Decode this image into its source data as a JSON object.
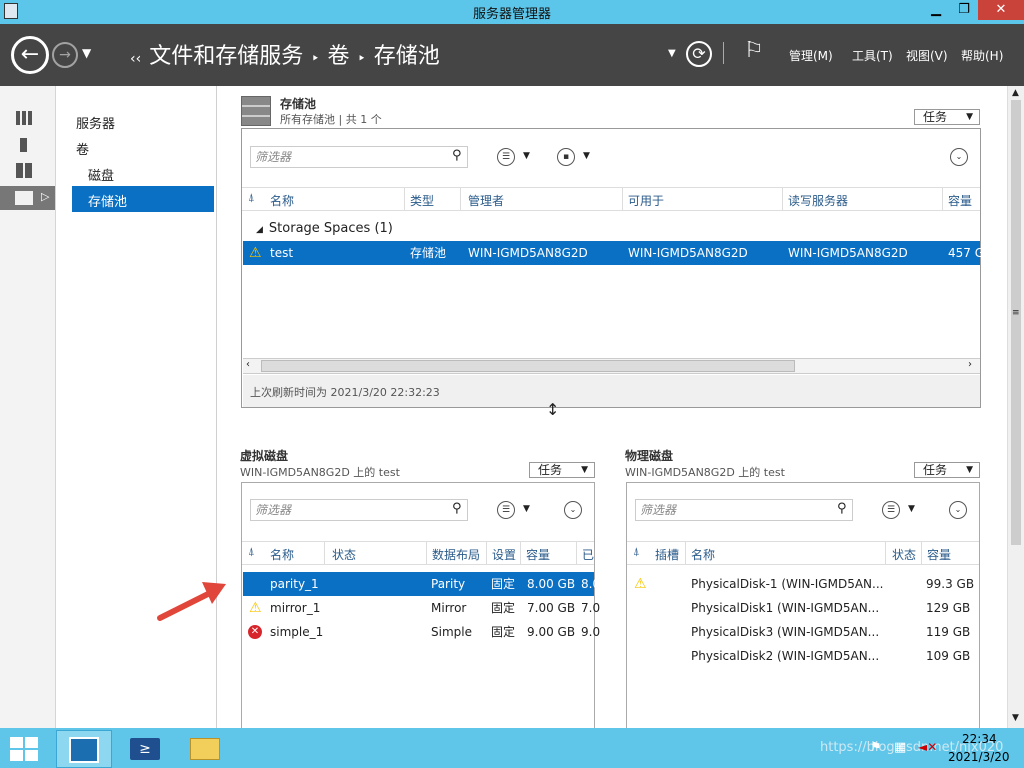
{
  "window": {
    "title": "服务器管理器",
    "min": "▁",
    "restore": "❐",
    "close": "✕"
  },
  "nav": {
    "breadcrumb": [
      "‹‹",
      "文件和存储服务",
      "‣",
      "卷",
      "‣",
      "存储池"
    ],
    "menus": [
      "管理(M)",
      "工具(T)",
      "视图(V)",
      "帮助(H)"
    ]
  },
  "leftnav": {
    "items": [
      "服务器",
      "卷",
      "磁盘",
      "存储池"
    ]
  },
  "pool": {
    "title": "存储池",
    "subtitle": "所有存储池 | 共 1 个",
    "task_label": "任务",
    "filter_placeholder": "筛选器",
    "columns": [
      "名称",
      "类型",
      "管理者",
      "可用于",
      "读写服务器",
      "容量"
    ],
    "group": "Storage Spaces (1)",
    "rows": [
      {
        "name": "test",
        "type": "存储池",
        "managed": "WIN-IGMD5AN8G2D",
        "available": "WIN-IGMD5AN8G2D",
        "rw": "WIN-IGMD5AN8G2D",
        "cap": "457 G"
      }
    ],
    "refresh": "上次刷新时间为 2021/3/20 22:32:23"
  },
  "vdisk": {
    "title": "虚拟磁盘",
    "subtitle": "WIN-IGMD5AN8G2D 上的 test",
    "task_label": "任务",
    "filter_placeholder": "筛选器",
    "columns": [
      "名称",
      "状态",
      "数据布局",
      "设置",
      "容量",
      "已"
    ],
    "rows": [
      {
        "name": "parity_1",
        "layout": "Parity",
        "set": "固定",
        "cap": "8.00 GB",
        "used": "8.0"
      },
      {
        "name": "mirror_1",
        "layout": "Mirror",
        "set": "固定",
        "cap": "7.00 GB",
        "used": "7.0"
      },
      {
        "name": "simple_1",
        "layout": "Simple",
        "set": "固定",
        "cap": "9.00 GB",
        "used": "9.0"
      }
    ]
  },
  "pdisk": {
    "title": "物理磁盘",
    "subtitle": "WIN-IGMD5AN8G2D 上的 test",
    "task_label": "任务",
    "filter_placeholder": "筛选器",
    "columns": [
      "插槽",
      "名称",
      "状态",
      "容量"
    ],
    "rows": [
      {
        "name": "PhysicalDisk-1 (WIN-IGMD5AN...",
        "cap": "99.3 GB"
      },
      {
        "name": "PhysicalDisk1 (WIN-IGMD5AN...",
        "cap": "129 GB"
      },
      {
        "name": "PhysicalDisk3 (WIN-IGMD5AN...",
        "cap": "119 GB"
      },
      {
        "name": "PhysicalDisk2 (WIN-IGMD5AN...",
        "cap": "109 GB"
      }
    ]
  },
  "taskbar": {
    "time": "22:34",
    "date": "2021/3/20",
    "watermark": "https://blog.csdn.net/njx020"
  },
  "colors": {
    "accent": "#0a70c4",
    "titlebar": "#5cc6ea",
    "navbar": "#454545",
    "close": "#c9433a",
    "arrow": "#e0463a"
  }
}
